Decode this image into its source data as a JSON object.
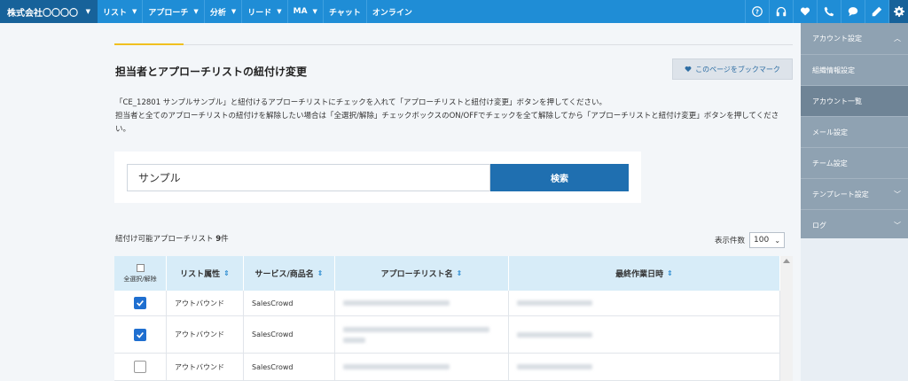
{
  "nav": {
    "brand": "株式会社〇〇〇〇",
    "items": [
      {
        "label": "リスト",
        "chevron": true
      },
      {
        "label": "アプローチ",
        "chevron": true
      },
      {
        "label": "分析",
        "chevron": true
      },
      {
        "label": "リード",
        "chevron": true
      },
      {
        "label": "MA",
        "chevron": true
      },
      {
        "label": "チャット",
        "chevron": false
      },
      {
        "label": "オンライン",
        "chevron": false
      }
    ],
    "icons": [
      "help-icon",
      "headset-icon",
      "heart-icon",
      "phone-icon",
      "chat-bubble-icon",
      "pencil-icon",
      "gear-icon"
    ]
  },
  "page": {
    "title": "担当者とアプローチリストの紐付け変更",
    "bookmark_label": "このページをブックマーク",
    "desc_line1": "「CE_12801 サンプルサンプル」と紐付けるアプローチリストにチェックを入れて「アプローチリストと紐付け変更」ボタンを押してください。",
    "desc_line2": "担当者と全てのアプローチリストの紐付けを解除したい場合は「全選択/解除」チェックボックスのON/OFFでチェックを全て解除してから「アプローチリストと紐付け変更」ボタンを押してください。"
  },
  "search": {
    "value": "サンプル",
    "button_label": "検索"
  },
  "list": {
    "count_label": "紐付け可能アプローチリスト",
    "count_value": "9",
    "count_unit": "件",
    "per_page_label": "表示件数",
    "per_page_value": "100"
  },
  "table": {
    "select_all_label": "全選択/解除",
    "headers": [
      "リスト属性",
      "サービス/商品名",
      "アプローチリスト名",
      "最終作業日時"
    ],
    "rows": [
      {
        "checked": true,
        "attribute": "アウトバウンド",
        "service": "SalesCrowd"
      },
      {
        "checked": true,
        "attribute": "アウトバウンド",
        "service": "SalesCrowd"
      },
      {
        "checked": false,
        "attribute": "アウトバウンド",
        "service": "SalesCrowd"
      }
    ]
  },
  "sidebar": {
    "header": "アカウント設定",
    "items": [
      {
        "label": "組織情報設定",
        "active": false,
        "chevron": false
      },
      {
        "label": "アカウント一覧",
        "active": true,
        "chevron": false
      },
      {
        "label": "メール設定",
        "active": false,
        "chevron": false
      },
      {
        "label": "チーム設定",
        "active": false,
        "chevron": false
      },
      {
        "label": "テンプレート設定",
        "active": false,
        "chevron": true
      },
      {
        "label": "ログ",
        "active": false,
        "chevron": true
      }
    ]
  },
  "colors": {
    "nav_bg": "#1f8dd6",
    "brand_bg": "#17629a",
    "primary_button": "#1f6fb0",
    "sidebar_bg": "#8fa2b2",
    "sidebar_active": "#6f8496",
    "accent": "#f0c020",
    "table_header": "#d7ecf8"
  }
}
